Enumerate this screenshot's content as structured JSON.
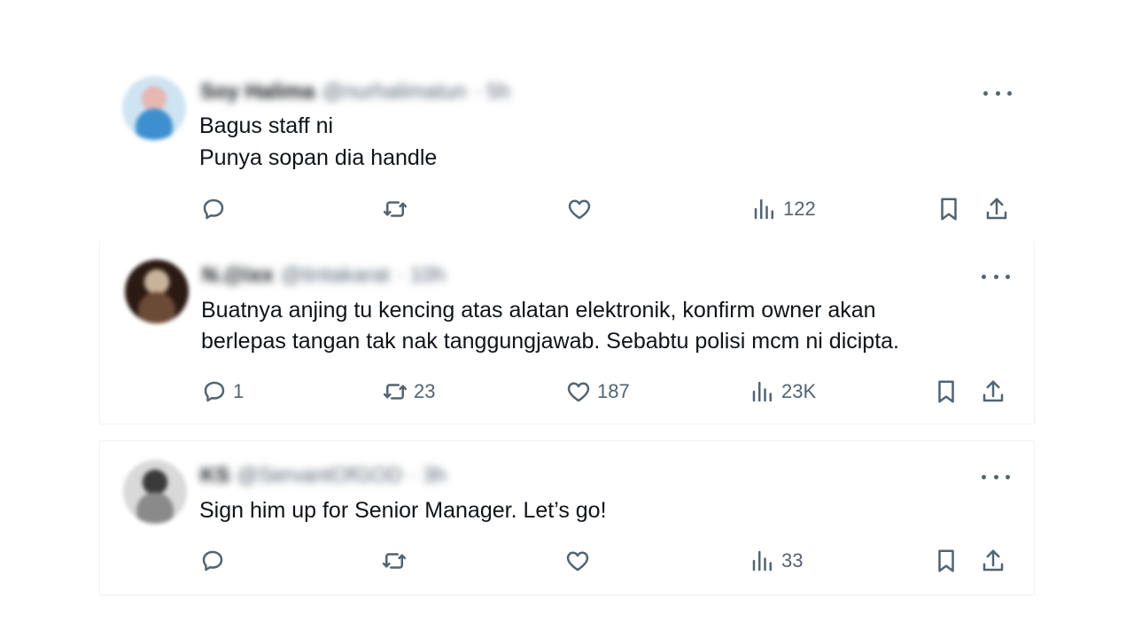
{
  "tweets": [
    {
      "author_name": "Soy Halima",
      "author_handle": "@nurhalimatun",
      "time": "· 5h",
      "lines": [
        "Bagus staff ni",
        "Punya sopan dia handle"
      ],
      "replies": "",
      "reposts": "",
      "likes": "",
      "views": "122",
      "avatar_colors": [
        "#cfe4f2",
        "#e7b7b4",
        "#3e8fcf"
      ]
    },
    {
      "author_name": "N.@ixx",
      "author_handle": "@tintakarat",
      "time": "· 10h",
      "lines": [
        "Buatnya anjing tu kencing atas alatan elektronik, konfirm owner akan",
        "berlepas tangan tak nak tanggungjawab. Sebabtu polisi mcm ni dicipta."
      ],
      "replies": "1",
      "reposts": "23",
      "likes": "187",
      "views": "23K",
      "avatar_colors": [
        "#2b1a12",
        "#c7b29a",
        "#6b4a36"
      ]
    },
    {
      "author_name": "KS",
      "author_handle": "@ServantOfGOD",
      "time": "· 3h",
      "lines": [
        "Sign him up for Senior Manager. Let’s go!"
      ],
      "replies": "",
      "reposts": "",
      "likes": "",
      "views": "33",
      "avatar_colors": [
        "#d9d9d9",
        "#3a3a3a",
        "#8a8a8a"
      ]
    }
  ],
  "icons": {
    "more": "more-icon",
    "reply": "reply-icon",
    "repost": "repost-icon",
    "like": "like-icon",
    "views": "views-icon",
    "bookmark": "bookmark-icon",
    "share": "share-icon"
  },
  "colors": {
    "text": "#0f1419",
    "secondary": "#536471",
    "border": "#eff3f4",
    "background": "#ffffff"
  }
}
